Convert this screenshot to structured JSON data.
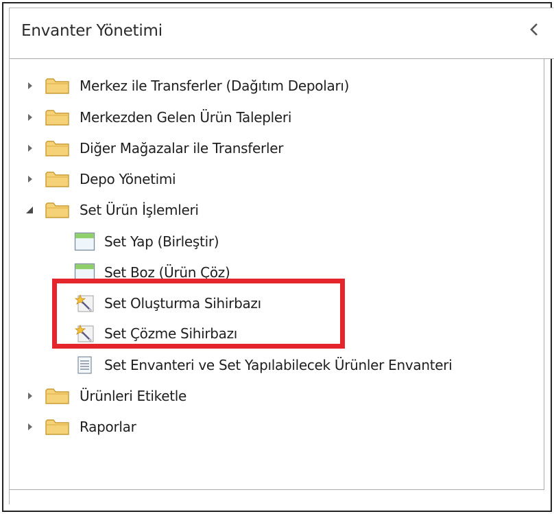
{
  "panel": {
    "title": "Envanter Yönetimi",
    "collapse_icon": "chevron-left-icon"
  },
  "tree": {
    "items": [
      {
        "label": "Merkez ile Transferler (Dağıtım Depoları)",
        "icon": "folder-icon",
        "expanded": false
      },
      {
        "label": "Merkezden Gelen Ürün Talepleri",
        "icon": "folder-icon",
        "expanded": false
      },
      {
        "label": "Diğer Mağazalar ile Transferler",
        "icon": "folder-icon",
        "expanded": false
      },
      {
        "label": "Depo Yönetimi",
        "icon": "folder-icon",
        "expanded": false
      },
      {
        "label": "Set Ürün İşlemleri",
        "icon": "folder-icon",
        "expanded": true,
        "children": [
          {
            "label": "Set Yap (Birleştir)",
            "icon": "form-window-icon"
          },
          {
            "label": "Set Boz (Ürün Çöz)",
            "icon": "form-window-icon"
          },
          {
            "label": "Set Oluşturma Sihirbazı",
            "icon": "magic-wand-icon"
          },
          {
            "label": "Set Çözme Sihirbazı",
            "icon": "magic-wand-icon"
          },
          {
            "label": "Set Envanteri ve Set Yapılabilecek Ürünler Envanteri",
            "icon": "report-list-icon"
          }
        ]
      },
      {
        "label": "Ürünleri Etiketle",
        "icon": "folder-icon",
        "expanded": false
      },
      {
        "label": "Raporlar",
        "icon": "folder-icon",
        "expanded": false
      }
    ]
  },
  "highlight": {
    "color": "#e5252c",
    "wraps": [
      "Set Oluşturma Sihirbazı",
      "Set Çözme Sihirbazı"
    ]
  },
  "colors": {
    "folder_fill": "#f5d178",
    "folder_stroke": "#c99a32",
    "form_header": "#8fcf6a",
    "form_body": "#eef5fb"
  }
}
